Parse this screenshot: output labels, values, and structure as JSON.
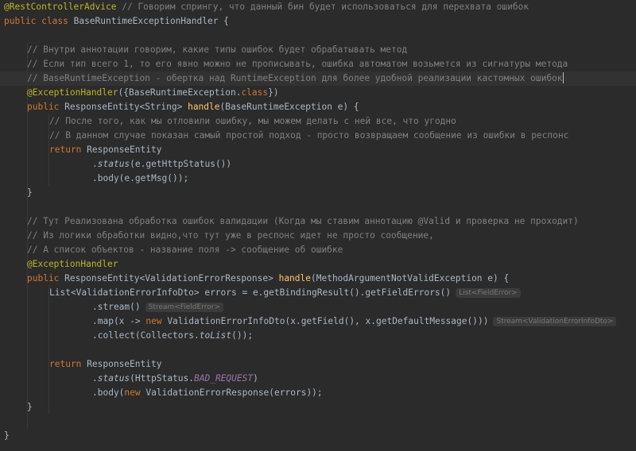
{
  "editor": {
    "language": "Java",
    "theme_colors": {
      "background": "#2b2b2b",
      "annotation": "#bbb529",
      "comment": "#808080",
      "keyword": "#cc7832",
      "method": "#ffc66d",
      "text": "#a9b7c6",
      "constant": "#9876aa"
    },
    "t": {
      "rca": "@RestControllerAdvice",
      "c0": "// Говорим спрингу, что данный бин будет использоваться для перехвата ошибок",
      "public": "public",
      "class": "class",
      "cls_name": " BaseRuntimeExceptionHandler {",
      "c1": "// Внутри аннотации говорим, какие типы ошибок будет обрабатывать метод",
      "c2": "// Если тип всего 1, то его явно можно не прописывать, ошибка автоматом возьмется из сигнатуры метода",
      "c3": "// BaseRuntimeException - обертка над RuntimeException для более удобной реализации кастомных ошибок",
      "eh": "@ExceptionHandler",
      "eh_args_a": "({BaseRuntimeException.",
      "class_kw": "class",
      "eh_args_b": "})",
      "m1_ret": " ResponseEntity<String> ",
      "handle": "handle",
      "m1_params": "(BaseRuntimeException e) {",
      "c4": "// После того, как мы отловили ошибку, мы можем делать с ней все, что угодно",
      "c5": "// В данном случае показан самый простой подход - просто возвращаем сообщение из ошибки в респонс",
      "return": "return",
      "resp_entity": " ResponseEntity",
      "dot": ".",
      "status": "status",
      "m1_status_args": "(e.getHttpStatus())",
      "m1_body": ".body(e.getMsg());",
      "close_brace": "}",
      "c6": "// Тут Реализована обработка ошибок валидации (Когда мы ставим аннотацию @Valid и проверка не проходит)",
      "c7": "// Из логики обработки видно,что тут уже в респонс идет не просто сообщение,",
      "c8": "// А список объектов - название поля -> сообщение об ошибке",
      "m2_ret": " ResponseEntity<ValidationErrorResponse> ",
      "m2_params": "(MethodArgumentNotValidException e) {",
      "list_decl": "List<ValidationErrorInfoDto> errors = e.getBindingResult().getFieldErrors()",
      "hint_list": "List<FieldError>",
      "stream": ".stream()",
      "hint_stream1": "Stream<FieldError>",
      "map_a": ".map(x -> ",
      "new": "new",
      "map_b": " ValidationErrorInfoDto(x.getField(), x.getDefaultMessage()))",
      "hint_stream2": "Stream<ValidationErrorInfoDto>",
      "collect_a": ".collect(Collectors.",
      "tolist": "toList",
      "collect_b": "());",
      "status_args_a": "(HttpStatus.",
      "bad_request": "BAD_REQUEST",
      "status_args_b": ")",
      "body_a": ".body(",
      "body_b": " ValidationErrorResponse(errors));"
    }
  }
}
